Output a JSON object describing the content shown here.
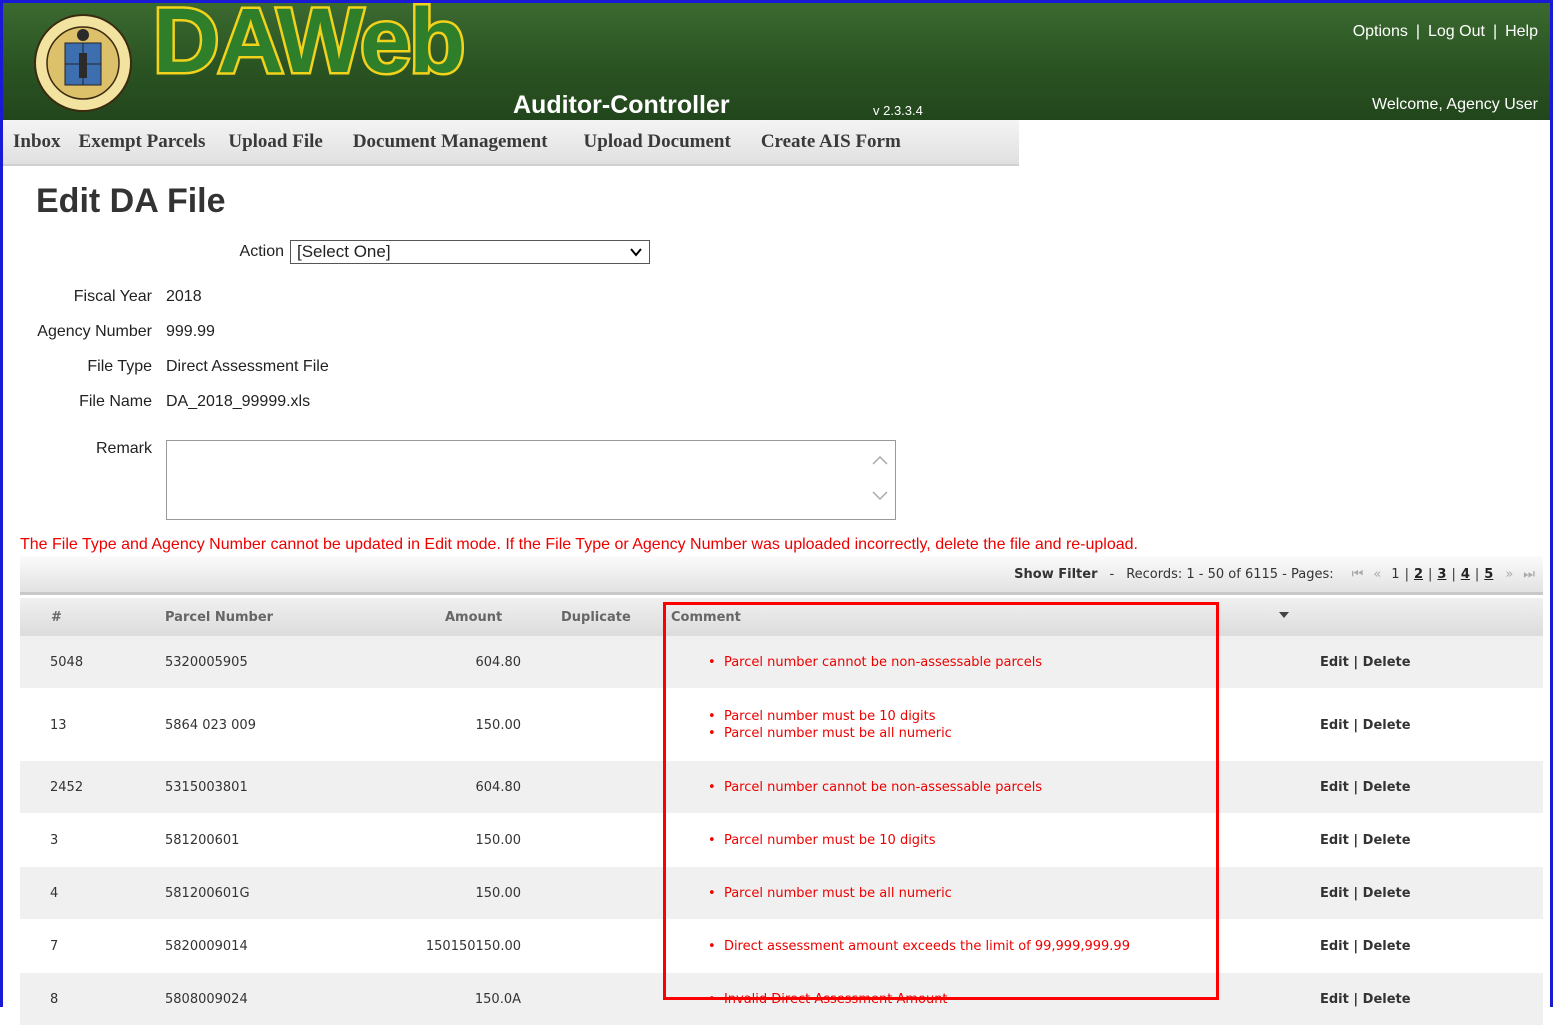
{
  "header": {
    "logo_text": "DAWeb",
    "department": "Auditor-Controller",
    "version": "v 2.3.3.4",
    "links": [
      "Options",
      "Log Out",
      "Help"
    ],
    "welcome": "Welcome, Agency User",
    "seal_alt": "County of Los Angeles seal",
    "seal_text_top": "COUNTY OF LOS ANGELES",
    "seal_text_bottom": "CALIFORNIA"
  },
  "nav": {
    "items": [
      "Inbox",
      "Exempt Parcels",
      "Upload File",
      "Document Management",
      "Upload Document",
      "Create AIS Form"
    ]
  },
  "page": {
    "title": "Edit DA File",
    "action_label": "Action",
    "action_value": "[Select One]",
    "fiscal_year_label": "Fiscal Year",
    "fiscal_year": "2018",
    "agency_number_label": "Agency Number",
    "agency_number": "999.99",
    "file_type_label": "File Type",
    "file_type": "Direct Assessment File",
    "file_name_label": "File Name",
    "file_name": "DA_2018_99999.xls",
    "remark_label": "Remark",
    "remark_value": "",
    "warning": "The File Type and Agency Number cannot be updated in Edit mode. If the File Type or Agency Number was uploaded incorrectly, delete the file and re-upload."
  },
  "grid": {
    "show_filter": "Show Filter",
    "records": "Records: 1 - 50 of 6115 - Pages:",
    "pages": [
      "1",
      "2",
      "3",
      "4",
      "5"
    ],
    "columns": [
      "#",
      "Parcel Number",
      "Amount",
      "Duplicate",
      "Comment"
    ],
    "edit_label": "Edit",
    "delete_label": "Delete",
    "rows": [
      {
        "num": "5048",
        "parcel": "5320005905",
        "amount": "604.80",
        "duplicate": "",
        "comments": [
          "Parcel number cannot be non-assessable parcels"
        ]
      },
      {
        "num": "13",
        "parcel": "5864 023 009",
        "amount": "150.00",
        "duplicate": "",
        "comments": [
          "Parcel number must be 10 digits",
          "Parcel number must be all numeric"
        ]
      },
      {
        "num": "2452",
        "parcel": "5315003801",
        "amount": "604.80",
        "duplicate": "",
        "comments": [
          "Parcel number cannot be non-assessable parcels"
        ]
      },
      {
        "num": "3",
        "parcel": "581200601",
        "amount": "150.00",
        "duplicate": "",
        "comments": [
          "Parcel number must be 10 digits"
        ]
      },
      {
        "num": "4",
        "parcel": "581200601G",
        "amount": "150.00",
        "duplicate": "",
        "comments": [
          "Parcel number must be all numeric"
        ]
      },
      {
        "num": "7",
        "parcel": "5820009014",
        "amount": "150150150.00",
        "duplicate": "",
        "comments": [
          "Direct assessment amount exceeds the limit of 99,999,999.99"
        ]
      },
      {
        "num": "8",
        "parcel": "5808009024",
        "amount": "150.0A",
        "duplicate": "",
        "comments": [
          "Invalid Direct Assessment Amount"
        ]
      }
    ]
  },
  "colors": {
    "header_green": "#2a5322",
    "error_red": "#ee0000",
    "highlight_box": "#ff0000",
    "frame_blue": "#1a1ad6"
  }
}
